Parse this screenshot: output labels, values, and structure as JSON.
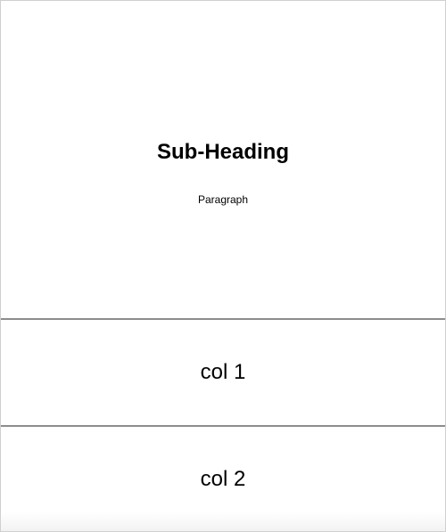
{
  "hero": {
    "title": "Sub-Heading",
    "paragraph": "Paragraph"
  },
  "columns": [
    {
      "label": "col 1"
    },
    {
      "label": "col 2"
    }
  ],
  "colors": {
    "background": "#ffffff",
    "text": "#000000",
    "divider": "#8c8c8c",
    "frame_border": "#d0d0d0"
  }
}
